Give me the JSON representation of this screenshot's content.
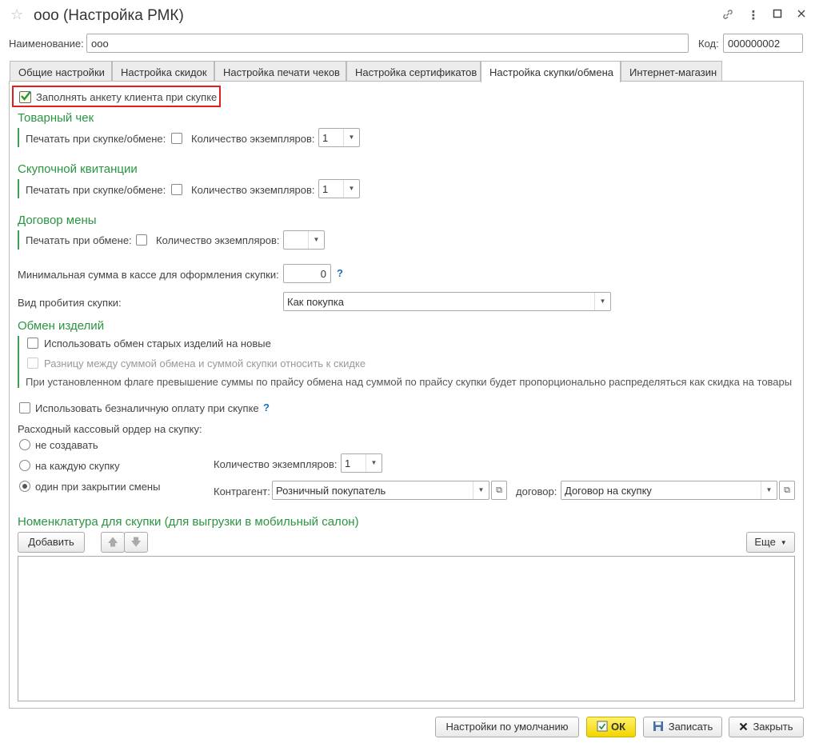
{
  "window": {
    "title": "ооо (Настройка РМК)",
    "icons": {
      "favorite": "star-icon",
      "link": "link-icon",
      "more": "more-icon",
      "maximize": "maximize-icon",
      "close": "close-icon"
    }
  },
  "header": {
    "name_label": "Наименование:",
    "name_value": "ооо",
    "code_label": "Код:",
    "code_value": "000000002"
  },
  "tabs": [
    {
      "label": "Общие настройки"
    },
    {
      "label": "Настройка скидок"
    },
    {
      "label": "Настройка печати чеков"
    },
    {
      "label": "Настройка сертификатов"
    },
    {
      "label": "Настройка скупки/обмена",
      "active": true
    },
    {
      "label": "Интернет-магазин"
    }
  ],
  "form": {
    "fill_profile": {
      "label": "Заполнять анкету клиента при скупке",
      "checked": true
    },
    "goods_receipt": {
      "title": "Товарный чек",
      "print_label": "Печатать при скупке/обмене:",
      "print_checked": false,
      "copies_label": "Количество экземпляров:",
      "copies_value": "1"
    },
    "buy_receipt": {
      "title": "Скупочной квитанции",
      "print_label": "Печатать при скупке/обмене:",
      "print_checked": false,
      "copies_label": "Количество экземпляров:",
      "copies_value": "1"
    },
    "exchange_contract": {
      "title": "Договор мены",
      "print_label": "Печатать при обмене:",
      "print_checked": false,
      "copies_label": "Количество экземпляров:",
      "copies_value": ""
    },
    "min_sum": {
      "label": "Минимальная сумма в кассе для оформления скупки:",
      "value": "0",
      "help": "?"
    },
    "punch_type": {
      "label": "Вид пробития скупки:",
      "value": "Как покупка"
    },
    "exchange": {
      "title": "Обмен изделий",
      "use_exchange": {
        "label": "Использовать обмен старых изделий на новые",
        "checked": false
      },
      "difference": {
        "label": "Разницу между суммой обмена и суммой скупки относить к скидке",
        "checked": false,
        "disabled": true
      },
      "note": "При установленном флаге превышение суммы по прайсу обмена над суммой по прайсу скупки будет пропорционально распределяться  как скидка на товары"
    },
    "cashless": {
      "label": "Использовать безналичную оплату при скупке",
      "checked": false,
      "help": "?"
    },
    "cash_order": {
      "label": "Расходный кассовый ордер на скупку:",
      "options": [
        {
          "label": "не создавать",
          "selected": false
        },
        {
          "label": "на каждую скупку",
          "selected": false
        },
        {
          "label": "один при закрытии смены",
          "selected": true
        }
      ],
      "copies_label": "Количество экземпляров:",
      "copies_value": "1",
      "counterparty_label": "Контрагент:",
      "counterparty_value": "Розничный покупатель",
      "contract_label": "договор:",
      "contract_value": "Договор на скупку"
    },
    "nomenclature": {
      "title": "Номенклатура для скупки (для выгрузки в мобильный салон)",
      "add_label": "Добавить",
      "more_label": "Еще",
      "rows": []
    }
  },
  "footer": {
    "defaults_label": "Настройки по умолчанию",
    "ok_label": "ОК",
    "save_label": "Записать",
    "close_label": "Закрыть"
  }
}
